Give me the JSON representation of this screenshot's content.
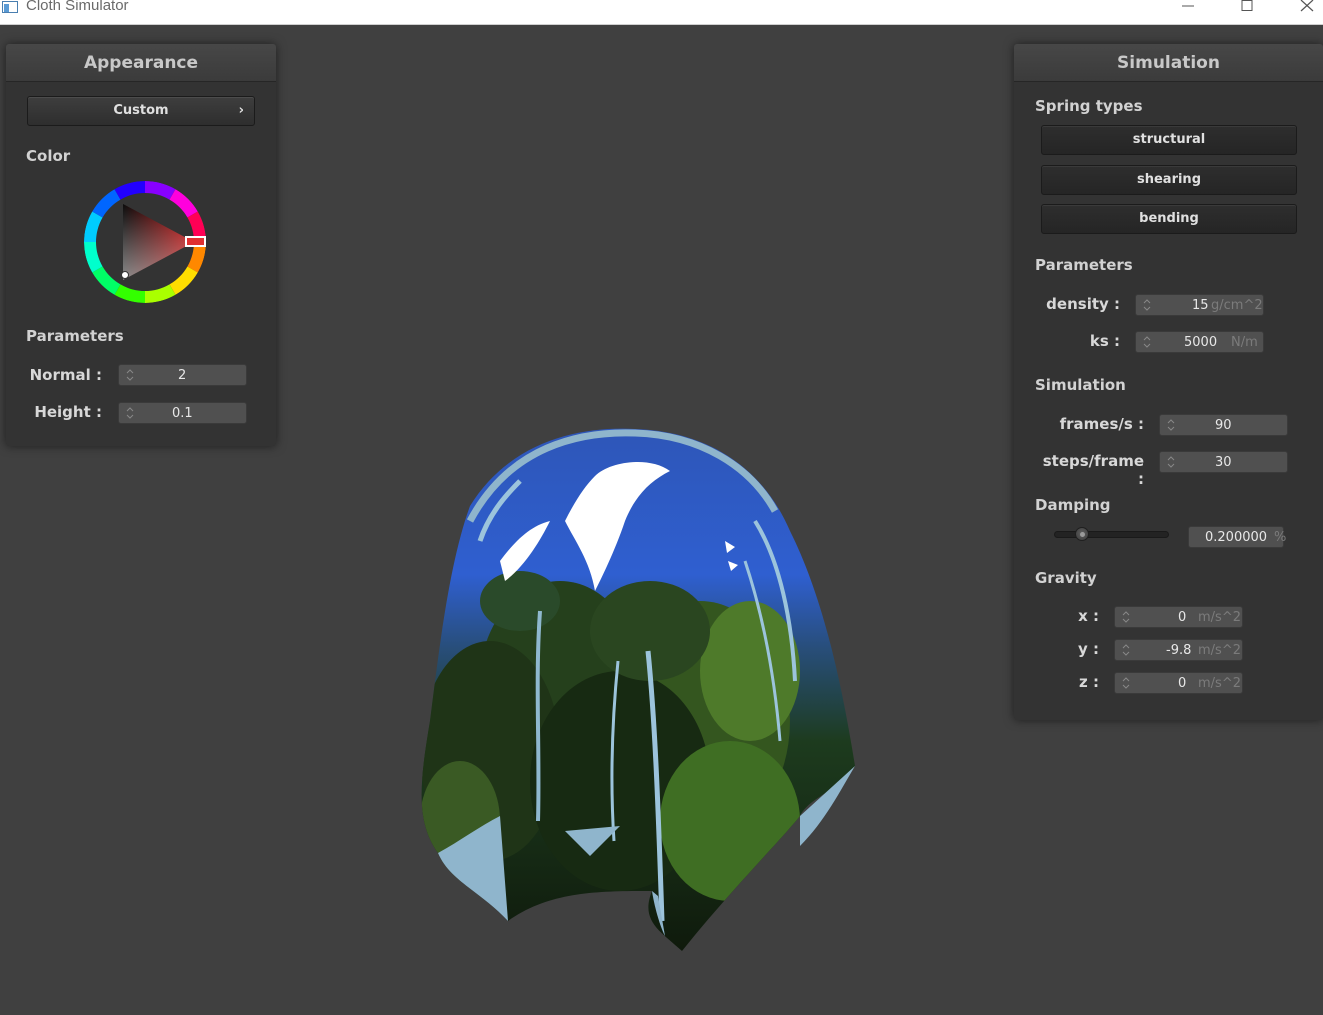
{
  "window": {
    "title": "Cloth Simulator"
  },
  "appearance": {
    "header": "Appearance",
    "preset": "Custom",
    "color_label": "Color",
    "selected_color": "#cc2020",
    "parameters_label": "Parameters",
    "normal": {
      "label": "Normal :",
      "value": "2"
    },
    "height": {
      "label": "Height :",
      "value": "0.1"
    }
  },
  "simulation": {
    "header": "Simulation",
    "spring_types_label": "Spring types",
    "springs": [
      "structural",
      "shearing",
      "bending"
    ],
    "parameters_label": "Parameters",
    "density": {
      "label": "density :",
      "value": "15",
      "unit": "g/cm^2"
    },
    "ks": {
      "label": "ks :",
      "value": "5000",
      "unit": "N/m"
    },
    "simulation_label": "Simulation",
    "frames": {
      "label": "frames/s :",
      "value": "90"
    },
    "steps": {
      "label": "steps/frame :",
      "value": "30"
    },
    "damping_label": "Damping",
    "damping": {
      "value": "0.200000",
      "unit": "%",
      "fraction": 0.2
    },
    "gravity_label": "Gravity",
    "gravity": [
      {
        "label": "x :",
        "value": "0",
        "unit": "m/s^2"
      },
      {
        "label": "y :",
        "value": "-9.8",
        "unit": "m/s^2"
      },
      {
        "label": "z :",
        "value": "0",
        "unit": "m/s^2"
      }
    ]
  }
}
